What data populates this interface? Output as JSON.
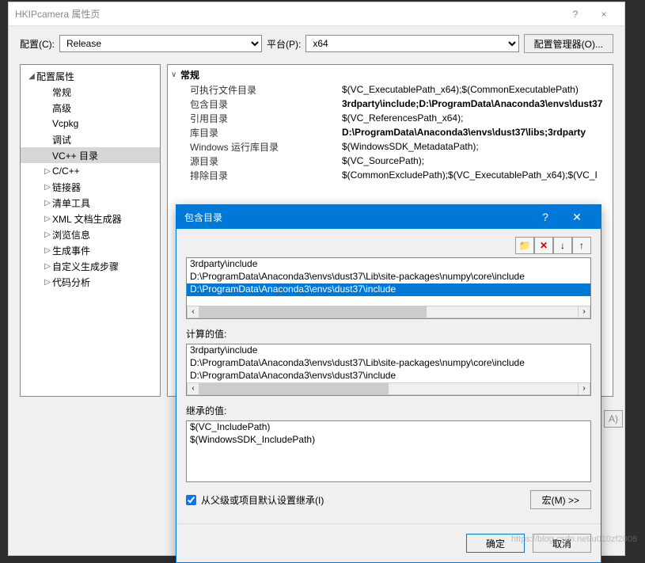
{
  "window": {
    "title": "HKIPcamera 属性页",
    "help": "?",
    "close": "×"
  },
  "configRow": {
    "configLabel": "配置(C):",
    "configValue": "Release",
    "platformLabel": "平台(P):",
    "platformValue": "x64",
    "managerBtn": "配置管理器(O)..."
  },
  "tree": [
    {
      "exp": "◢",
      "label": "配置属性",
      "ind": 0
    },
    {
      "exp": "",
      "label": "常规",
      "ind": 1
    },
    {
      "exp": "",
      "label": "高级",
      "ind": 1
    },
    {
      "exp": "",
      "label": "Vcpkg",
      "ind": 1
    },
    {
      "exp": "",
      "label": "调试",
      "ind": 1
    },
    {
      "exp": "",
      "label": "VC++ 目录",
      "ind": 1,
      "sel": true
    },
    {
      "exp": "▷",
      "label": "C/C++",
      "ind": 1
    },
    {
      "exp": "▷",
      "label": "链接器",
      "ind": 1
    },
    {
      "exp": "▷",
      "label": "清单工具",
      "ind": 1
    },
    {
      "exp": "▷",
      "label": "XML 文档生成器",
      "ind": 1
    },
    {
      "exp": "▷",
      "label": "浏览信息",
      "ind": 1
    },
    {
      "exp": "▷",
      "label": "生成事件",
      "ind": 1
    },
    {
      "exp": "▷",
      "label": "自定义生成步骤",
      "ind": 1
    },
    {
      "exp": "▷",
      "label": "代码分析",
      "ind": 1
    }
  ],
  "grid": {
    "header": "常规",
    "rows": [
      {
        "label": "可执行文件目录",
        "value": "$(VC_ExecutablePath_x64);$(CommonExecutablePath)",
        "bold": false
      },
      {
        "label": "包含目录",
        "value": "3rdparty\\include;D:\\ProgramData\\Anaconda3\\envs\\dust37",
        "bold": true
      },
      {
        "label": "引用目录",
        "value": "$(VC_ReferencesPath_x64);",
        "bold": false
      },
      {
        "label": "库目录",
        "value": "D:\\ProgramData\\Anaconda3\\envs\\dust37\\libs;3rdparty",
        "bold": true
      },
      {
        "label": "Windows 运行库目录",
        "value": "$(WindowsSDK_MetadataPath);",
        "bold": false
      },
      {
        "label": "源目录",
        "value": "$(VC_SourcePath);",
        "bold": false
      },
      {
        "label": "排除目录",
        "value": "$(CommonExcludePath);$(VC_ExecutablePath_x64);$(VC_I",
        "bold": false
      }
    ]
  },
  "popup": {
    "title": "包含目录",
    "help": "?",
    "close": "✕",
    "toolbar": {
      "new": "📁",
      "del": "✕",
      "down": "↓",
      "up": "↑"
    },
    "list": [
      {
        "text": "3rdparty\\include",
        "sel": false
      },
      {
        "text": "D:\\ProgramData\\Anaconda3\\envs\\dust37\\Lib\\site-packages\\numpy\\core\\include",
        "sel": false
      },
      {
        "text": "D:\\ProgramData\\Anaconda3\\envs\\dust37\\include",
        "sel": true
      }
    ],
    "computedLabel": "计算的值:",
    "computed": [
      "3rdparty\\include",
      "D:\\ProgramData\\Anaconda3\\envs\\dust37\\Lib\\site-packages\\numpy\\core\\include",
      "D:\\ProgramData\\Anaconda3\\envs\\dust37\\include"
    ],
    "inheritLabel": "继承的值:",
    "inherited": [
      "$(VC_IncludePath)",
      "$(WindowsSDK_IncludePath)"
    ],
    "checkboxLabel": "从父级或项目默认设置继承(I)",
    "checkboxChecked": true,
    "macroBtn": "宏(M) >>",
    "ok": "确定",
    "cancel": "取消"
  },
  "applyBtn": "A)",
  "watermark": "https://blog.csdn.net/u010zf2008"
}
